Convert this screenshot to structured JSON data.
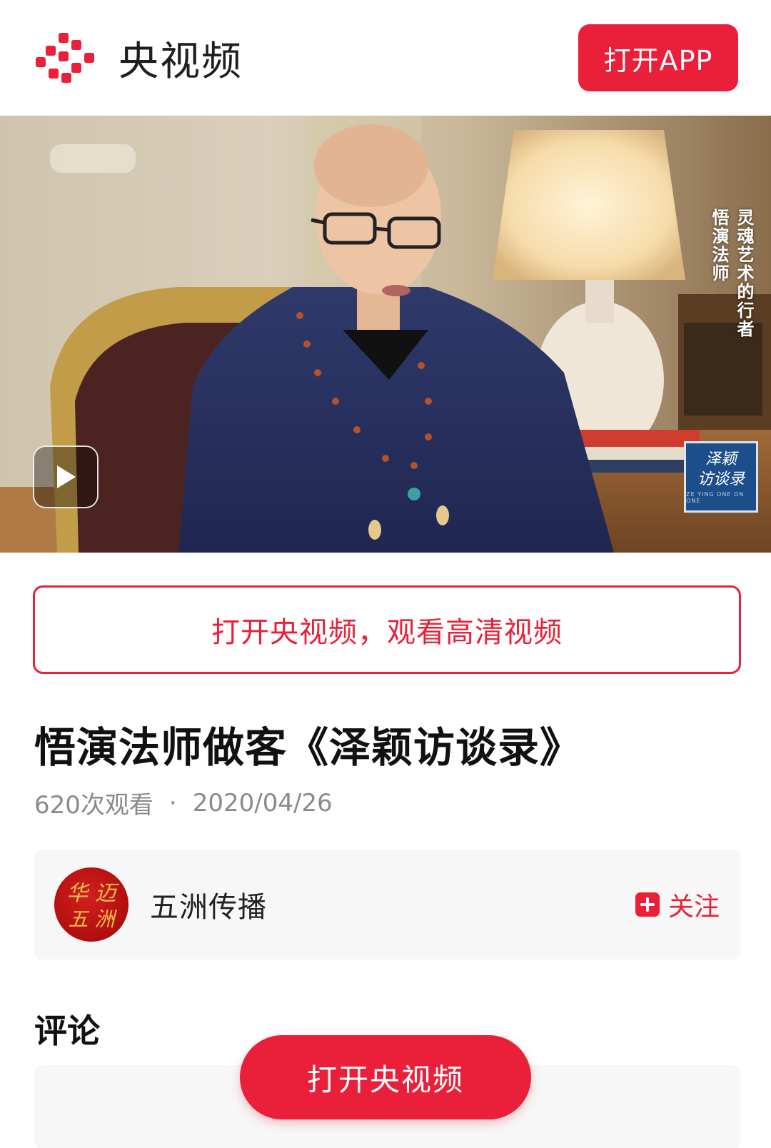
{
  "header": {
    "brand_name": "央视频",
    "open_app_label": "打开APP"
  },
  "video": {
    "caption_line1": "灵魂艺术的行者",
    "caption_line2": "悟演法师",
    "show_badge_line1": "泽颖",
    "show_badge_line2": "访谈录",
    "show_badge_small": "ZE YING ONE ON ONE",
    "play_icon": "play-icon"
  },
  "hd_banner": {
    "label": "打开央视频，观看高清视频"
  },
  "content": {
    "title": "悟演法师做客《泽颖访谈录》",
    "views": "620次观看",
    "separator": "·",
    "date": "2020/04/26"
  },
  "author": {
    "name": "五洲传播",
    "avatar_text_line1": "华 迈",
    "avatar_text_line2": "五 洲",
    "follow_label": "关注"
  },
  "comments": {
    "heading": "评论"
  },
  "cta": {
    "open_label": "打开央视频"
  },
  "colors": {
    "accent": "#ea1f3a",
    "text_primary": "#111111",
    "text_secondary": "#8a8a8a",
    "card_bg": "#f7f7f7"
  }
}
